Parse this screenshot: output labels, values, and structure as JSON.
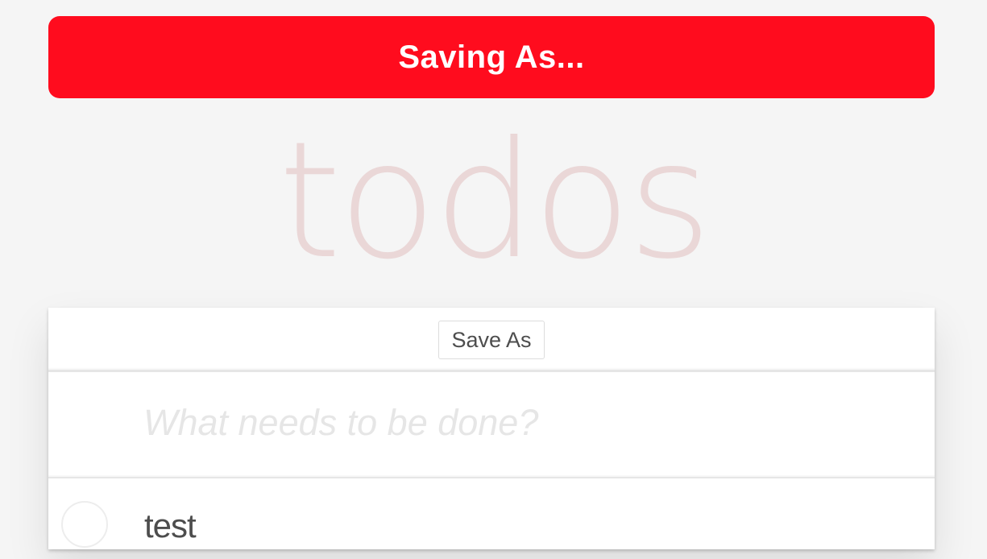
{
  "banner": {
    "text": "Saving As..."
  },
  "app": {
    "title": "todos"
  },
  "toolbar": {
    "save_as_label": "Save As"
  },
  "new_todo": {
    "placeholder": "What needs to be done?",
    "value": ""
  },
  "todos": [
    {
      "label": "test",
      "completed": false
    }
  ],
  "colors": {
    "banner_bg": "#ff0c1e",
    "page_bg": "#f5f5f5",
    "title_color": "rgba(175,47,47,0.15)"
  }
}
